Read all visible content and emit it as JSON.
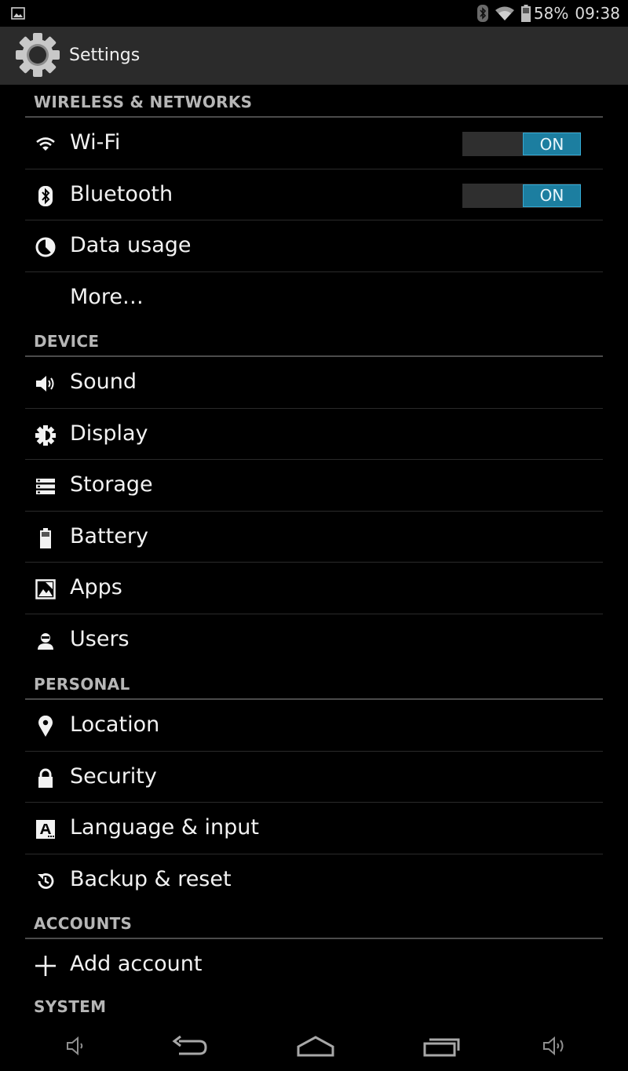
{
  "status_bar": {
    "notification_icon": "image-notification-icon",
    "icons": [
      "bluetooth-icon",
      "wifi-icon",
      "battery-icon"
    ],
    "battery_percent": "58%",
    "time": "09:38"
  },
  "action_bar": {
    "icon": "settings-gear-icon",
    "title": "Settings"
  },
  "sections": {
    "wireless": {
      "header": "WIRELESS & NETWORKS",
      "items": [
        {
          "label": "Wi-Fi",
          "icon": "wifi-icon",
          "toggle": "ON"
        },
        {
          "label": "Bluetooth",
          "icon": "bluetooth-icon",
          "toggle": "ON"
        },
        {
          "label": "Data usage",
          "icon": "data-usage-icon"
        },
        {
          "label": "More…",
          "icon": ""
        }
      ]
    },
    "device": {
      "header": "DEVICE",
      "items": [
        {
          "label": "Sound",
          "icon": "sound-icon"
        },
        {
          "label": "Display",
          "icon": "display-icon"
        },
        {
          "label": "Storage",
          "icon": "storage-icon"
        },
        {
          "label": "Battery",
          "icon": "battery-icon"
        },
        {
          "label": "Apps",
          "icon": "apps-icon"
        },
        {
          "label": "Users",
          "icon": "users-icon"
        }
      ]
    },
    "personal": {
      "header": "PERSONAL",
      "items": [
        {
          "label": "Location",
          "icon": "location-icon"
        },
        {
          "label": "Security",
          "icon": "lock-icon"
        },
        {
          "label": "Language & input",
          "icon": "language-icon"
        },
        {
          "label": "Backup & reset",
          "icon": "backup-reset-icon"
        }
      ]
    },
    "accounts": {
      "header": "ACCOUNTS",
      "items": [
        {
          "label": "Add account",
          "icon": "plus-icon"
        }
      ]
    },
    "system": {
      "header": "SYSTEM"
    }
  },
  "nav_bar": {
    "buttons": [
      "volume-down-icon",
      "back-icon",
      "home-icon",
      "recent-apps-icon",
      "volume-up-icon"
    ]
  },
  "colors": {
    "accent": "#1c7ea0",
    "action_bar_bg": "#2b2b2b",
    "section_header_text": "#b6b6b6"
  }
}
